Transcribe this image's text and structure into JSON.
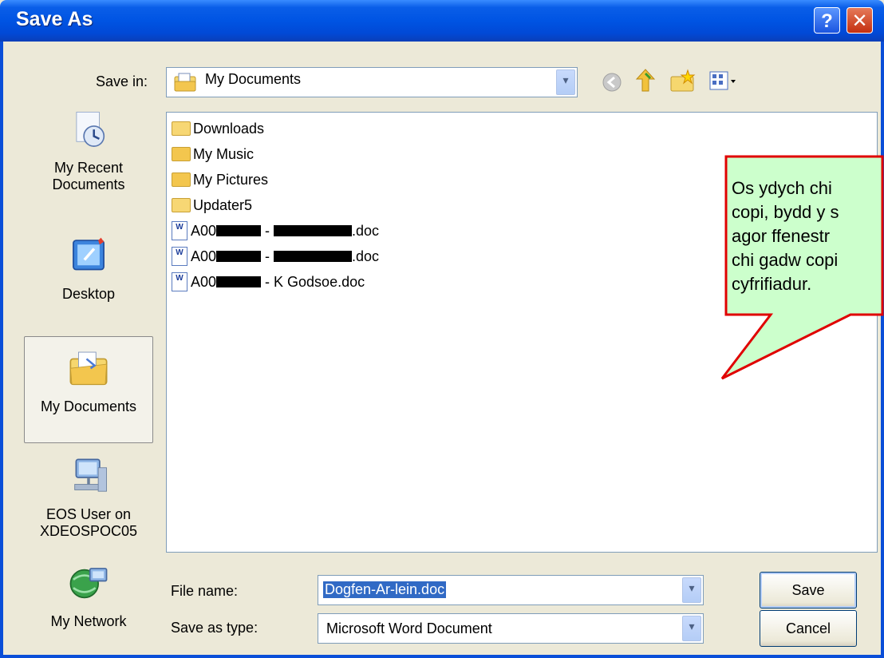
{
  "window": {
    "title": "Save As",
    "help_label": "?",
    "close_label": "✕"
  },
  "save_in": {
    "label": "Save in:",
    "value": "My Documents"
  },
  "toolbar": {
    "icons": [
      "back-icon",
      "up-folder-icon",
      "new-folder-icon",
      "views-icon"
    ]
  },
  "places": [
    {
      "line1": "My Recent",
      "line2": "Documents",
      "icon": "recent-documents-icon"
    },
    {
      "line1": "Desktop",
      "line2": "",
      "icon": "desktop-icon"
    },
    {
      "line1": "My Documents",
      "line2": "",
      "icon": "my-documents-icon",
      "selected": true
    },
    {
      "line1": "EOS User on",
      "line2": "XDEOSPOC05",
      "icon": "network-drive-icon"
    },
    {
      "line1": "My Network",
      "line2": "",
      "icon": "my-network-icon"
    }
  ],
  "files": [
    {
      "name": "Downloads",
      "type": "folder"
    },
    {
      "name": "My Music",
      "type": "folder"
    },
    {
      "name": "My Pictures",
      "type": "folder"
    },
    {
      "name": "Updater5",
      "type": "folder"
    },
    {
      "prefix": "A00",
      "mid": " - ",
      "suffix": ".doc",
      "type": "doc"
    },
    {
      "prefix": "A00",
      "mid": " - ",
      "suffix": ".doc",
      "type": "doc"
    },
    {
      "prefix": "A00",
      "mid": " - K Godsoe.doc",
      "suffix": "",
      "type": "doc"
    }
  ],
  "callout": {
    "lines": [
      "Os ydych chi",
      "copi, bydd y s",
      "agor ffenestr",
      "chi gadw copi",
      "cyfrifiadur."
    ],
    "border_color": "#e00000",
    "fill_color": "#ccffcc"
  },
  "file_name": {
    "label": "File name:",
    "value": "Dogfen-Ar-lein.doc"
  },
  "save_as_type": {
    "label": "Save as type:",
    "value": "Microsoft Word Document"
  },
  "buttons": {
    "save": "Save",
    "cancel": "Cancel"
  }
}
